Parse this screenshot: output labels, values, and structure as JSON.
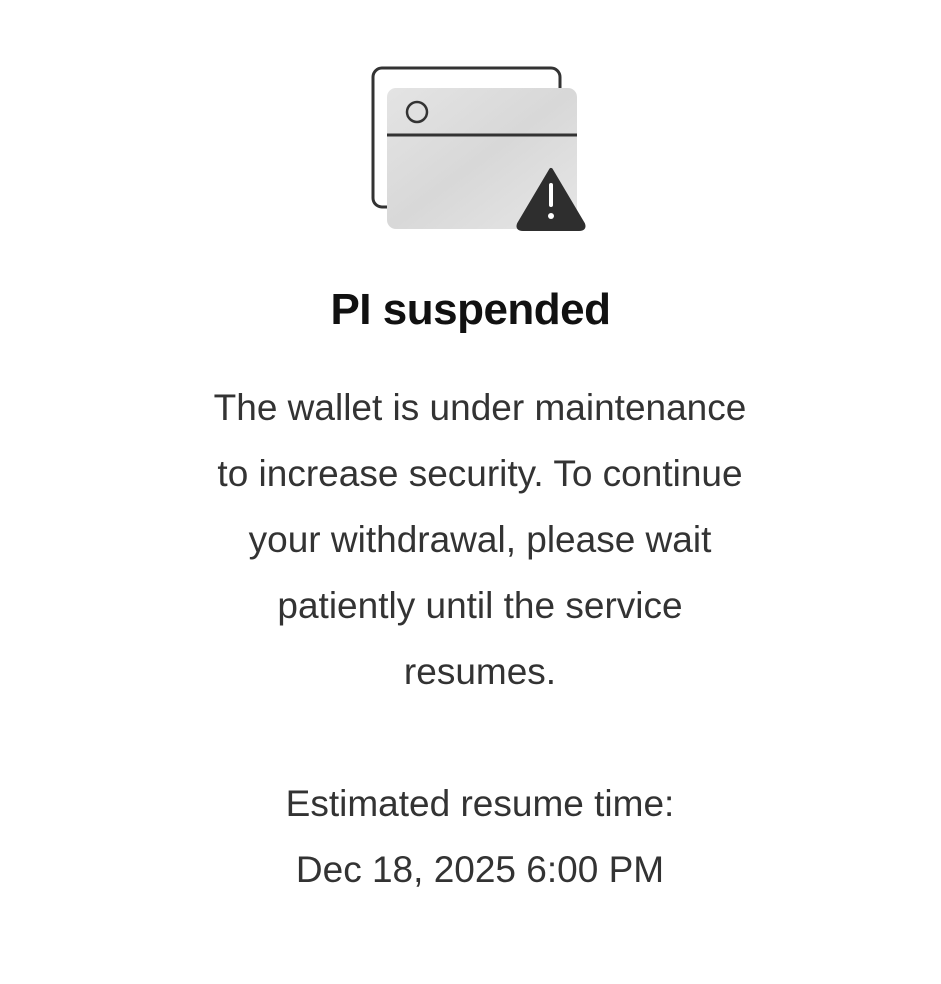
{
  "dialog": {
    "illustration_icon": "card-warning-icon",
    "title": "PI suspended",
    "message_lines": [
      "The wallet is under maintenance",
      "to increase security. To continue",
      "your withdrawal, please wait",
      "patiently until the service",
      "resumes."
    ],
    "resume_label": "Estimated resume time:",
    "resume_time": "Dec 18, 2025 6:00 PM"
  },
  "colors": {
    "background": "#ffffff",
    "title": "#111111",
    "body_text": "#333333",
    "icon_stroke": "#333333",
    "warning_triangle": "#2e2e2e"
  }
}
